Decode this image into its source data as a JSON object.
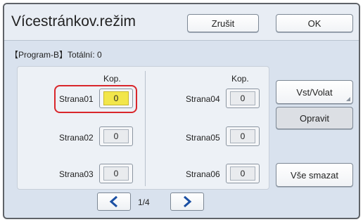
{
  "header": {
    "title": "Vícestránkov.režim",
    "cancel_label": "Zrušit",
    "ok_label": "OK"
  },
  "program_line": "【Program-B】Totální: 0",
  "columns": {
    "left_header": "Kop.",
    "right_header": "Kop."
  },
  "pages": [
    {
      "label": "Strana01",
      "value": "0"
    },
    {
      "label": "Strana02",
      "value": "0"
    },
    {
      "label": "Strana03",
      "value": "0"
    },
    {
      "label": "Strana04",
      "value": "0"
    },
    {
      "label": "Strana05",
      "value": "0"
    },
    {
      "label": "Strana06",
      "value": "0"
    }
  ],
  "side_buttons": {
    "vst_volat": "Vst/Volat",
    "opravit": "Opravit",
    "vse_smazat": "Vše smazat"
  },
  "pagination": {
    "indicator": "1/4",
    "prev_icon": "chevron-left-icon",
    "next_icon": "chevron-right-icon"
  },
  "colors": {
    "selected_value": "#f2e64a",
    "highlight": "#d9262b",
    "nav_arrow": "#1a4fa3"
  }
}
